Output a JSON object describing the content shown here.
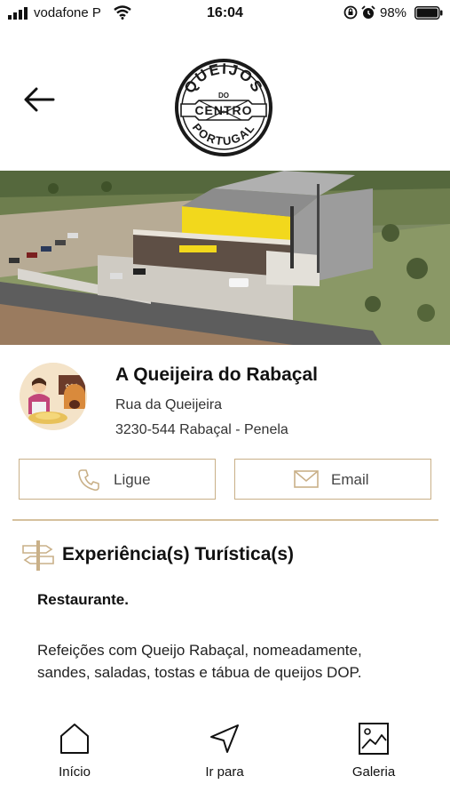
{
  "status_bar": {
    "carrier": "vodafone P",
    "time": "16:04",
    "battery": "98%"
  },
  "header": {
    "logo_text_top": "QUEIJOS",
    "logo_text_middle_small": "DO",
    "logo_text_middle": "CENTRO",
    "logo_text_bottom": "PORTUGAL"
  },
  "place": {
    "name": "A Queijeira do Rabaçal",
    "address_line1": "Rua da Queijeira",
    "address_line2": "3230-544 Rabaçal - Penela"
  },
  "actions": {
    "call_label": "Ligue",
    "email_label": "Email"
  },
  "experience": {
    "title": "Experiência(s) Turística(s)",
    "subheading": "Restaurante.",
    "description": "Refeições com Queijo Rabaçal, nomeadamente, sandes, saladas, tostas e tábua de queijos DOP."
  },
  "tab_bar": {
    "home_label": "Início",
    "goto_label": "Ir para",
    "gallery_label": "Galeria"
  },
  "colors": {
    "accent_gold": "#c9b088",
    "text": "#111111"
  }
}
